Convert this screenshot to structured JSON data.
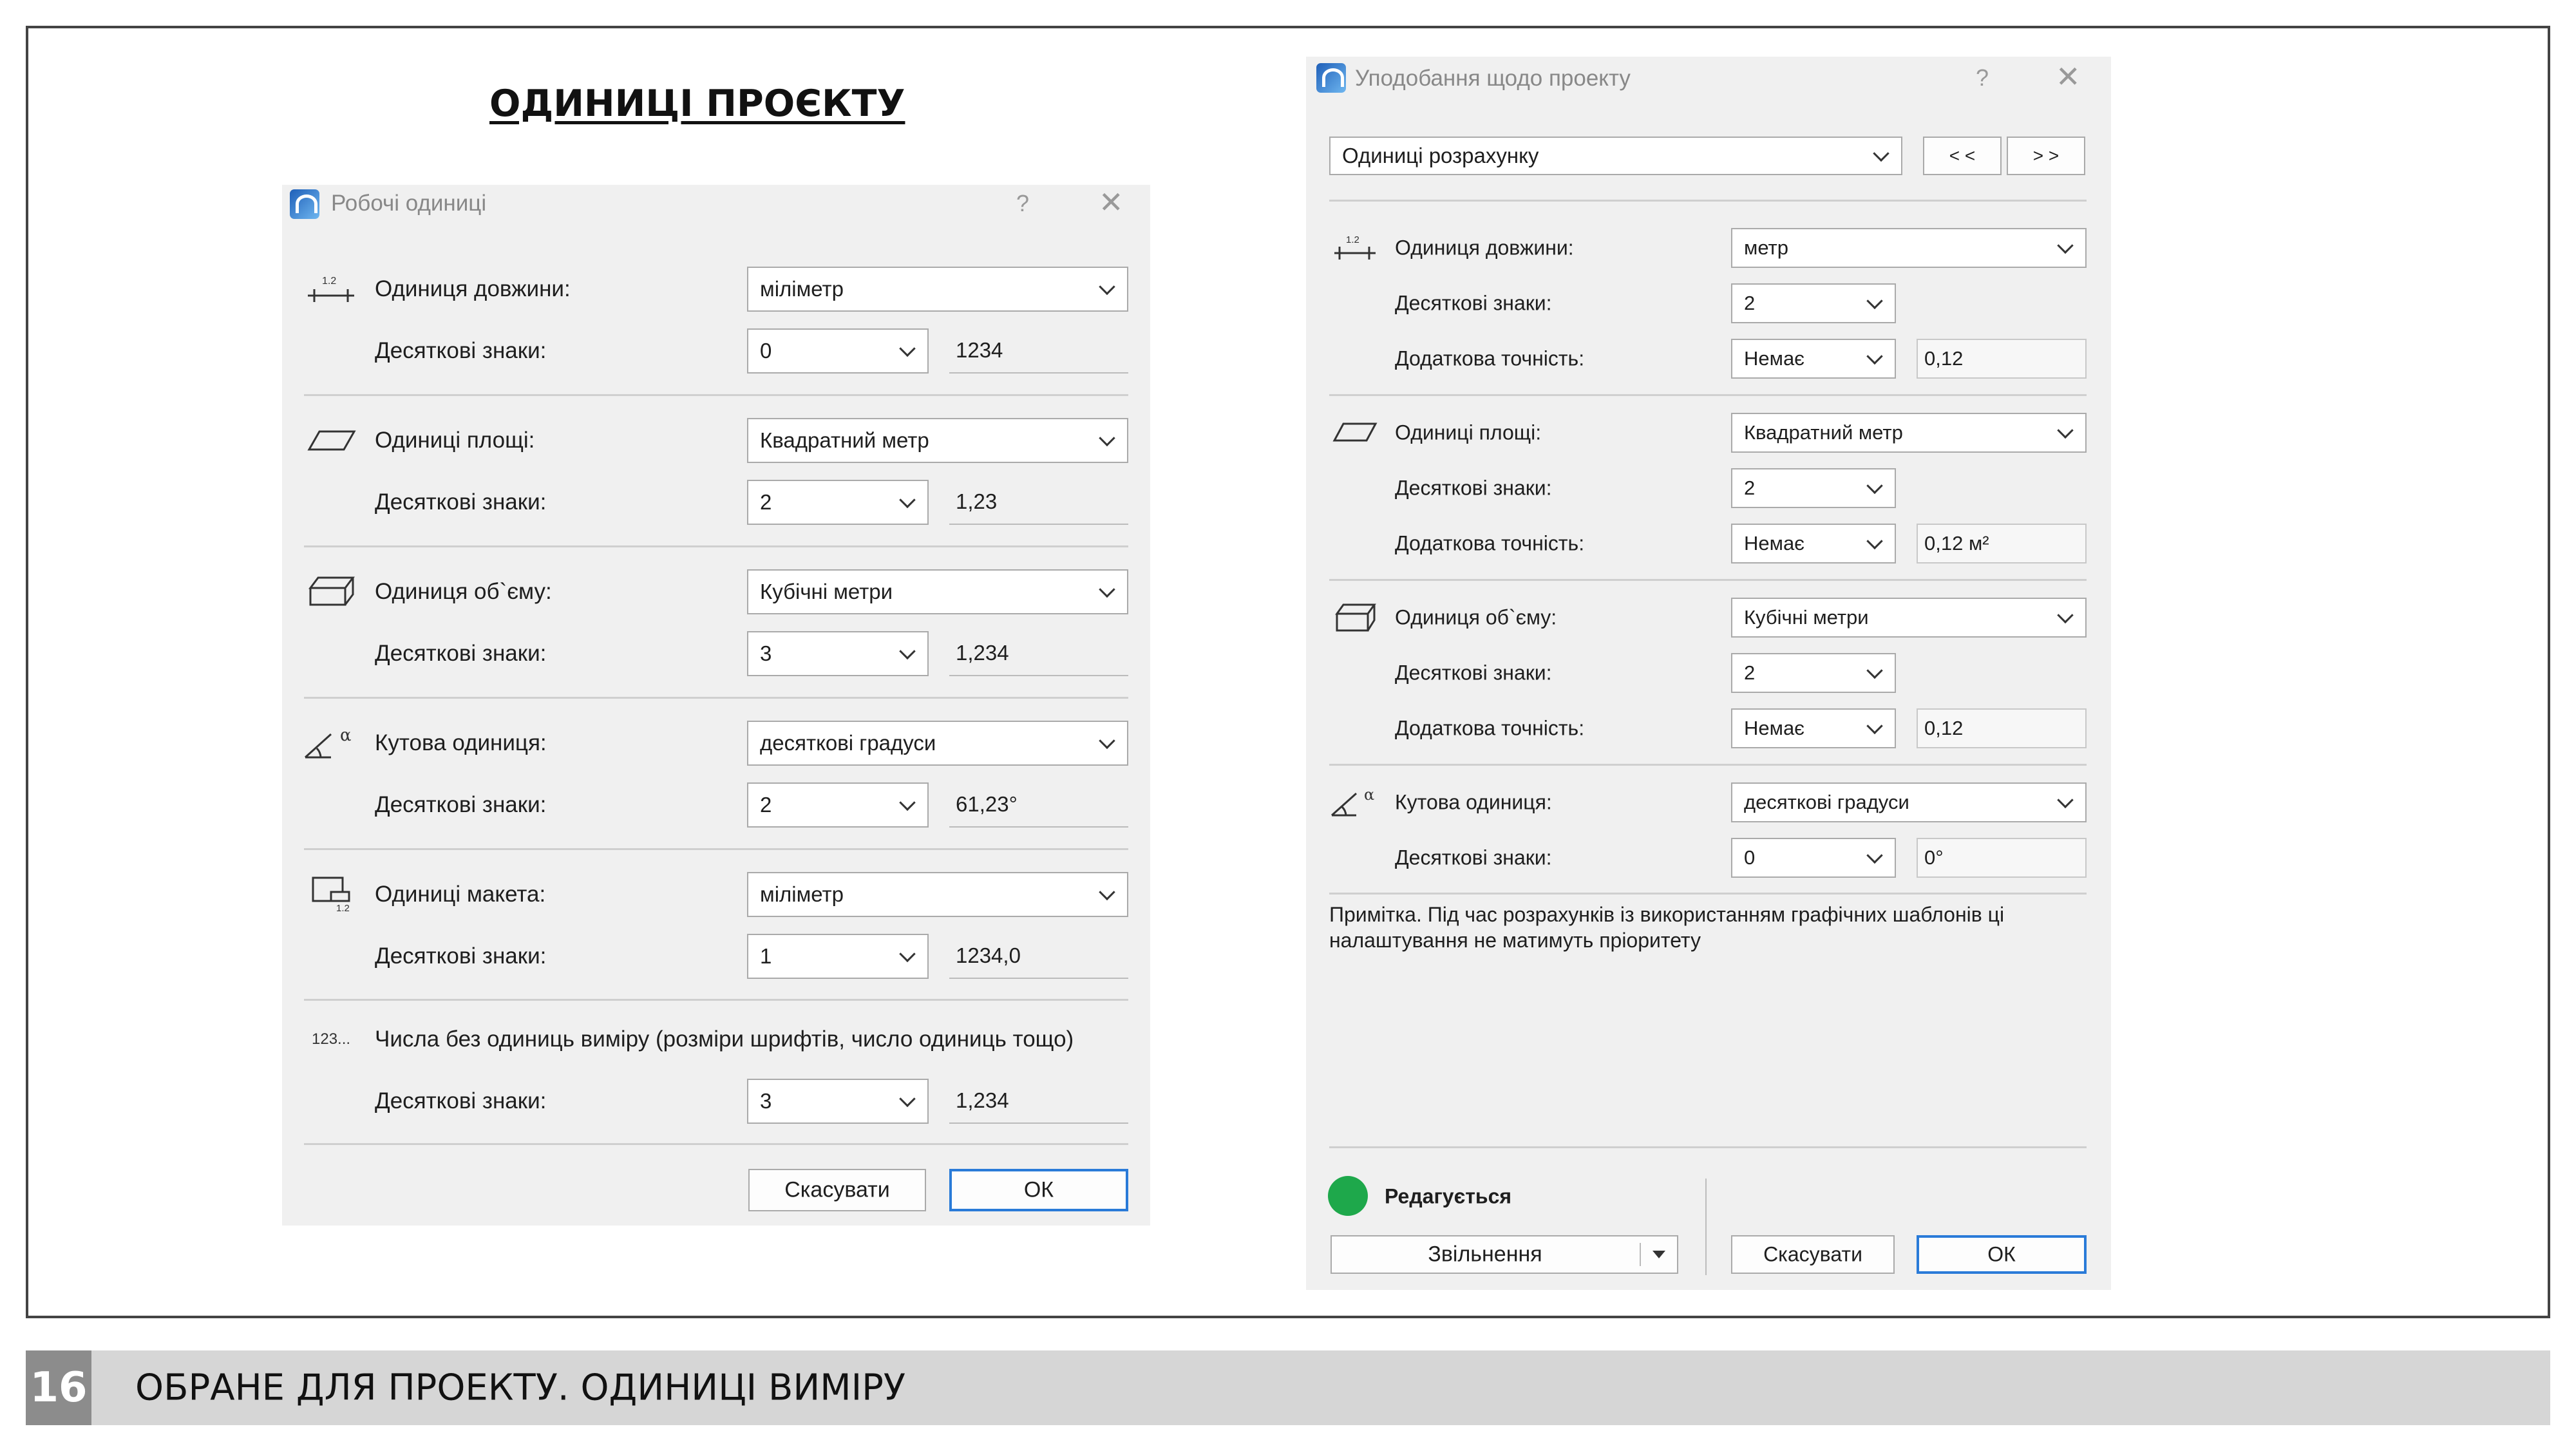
{
  "slide": {
    "title": "ОДИНИЦІ ПРОЄКТУ",
    "page_number": "16",
    "footer": "ОБРАНЕ ДЛЯ ПРОЕКТУ. ОДИНИЦІ ВИМІРУ"
  },
  "working_units": {
    "title": "Робочі одиниці",
    "help": "?",
    "close": "✕",
    "decimals_label": "Десяткові знаки:",
    "length": {
      "label": "Одиниця довжини:",
      "icon_text": "1.2",
      "unit": "міліметр",
      "decimals": "0",
      "preview": "1234"
    },
    "area": {
      "label": "Одиниці площі:",
      "unit": "Квадратний метр",
      "decimals": "2",
      "preview": "1,23"
    },
    "volume": {
      "label": "Одиниця об`єму:",
      "unit": "Кубічні метри",
      "decimals": "3",
      "preview": "1,234"
    },
    "angle": {
      "label": "Кутова одиниця:",
      "icon_text": "α",
      "unit": "десяткові градуси",
      "decimals": "2",
      "preview": "61,23°"
    },
    "model": {
      "label": "Одиниці макета:",
      "icon_text": "1.2",
      "unit": "міліметр",
      "decimals": "1",
      "preview": "1234,0"
    },
    "unitless": {
      "label": "Числа без одиниць виміру (розміри шрифтів, число одиниць тощо)",
      "icon_text": "123...",
      "decimals": "3",
      "preview": "1,234"
    },
    "cancel_label": "Скасувати",
    "ok_label": "ОК"
  },
  "project_prefs": {
    "title": "Уподобання щодо проекту",
    "help": "?",
    "close": "✕",
    "page_selector": "Одиниці розрахунку",
    "prev_label": "< <",
    "next_label": "> >",
    "decimals_label": "Десяткові знаки:",
    "precision_label": "Додаткова точність:",
    "length": {
      "label": "Одиниця довжини:",
      "icon_text": "1.2",
      "unit": "метр",
      "decimals": "2",
      "precision": "Немає",
      "preview": "0,12"
    },
    "area": {
      "label": "Одиниці площі:",
      "unit": "Квадратний метр",
      "decimals": "2",
      "precision": "Немає",
      "preview": "0,12 м²"
    },
    "volume": {
      "label": "Одиниця об`єму:",
      "unit": "Кубічні метри",
      "decimals": "2",
      "precision": "Немає",
      "preview": "0,12"
    },
    "angle": {
      "label": "Кутова одиниця:",
      "icon_text": "α",
      "unit": "десяткові градуси",
      "decimals": "0",
      "preview": "0°"
    },
    "note": "Примітка. Під час розрахунків із використанням графічних шаблонів ці налаштування не матимуть пріоритету",
    "status": "Редагується",
    "release_label": "Звільнення",
    "cancel_label": "Скасувати",
    "ok_label": "ОК"
  }
}
